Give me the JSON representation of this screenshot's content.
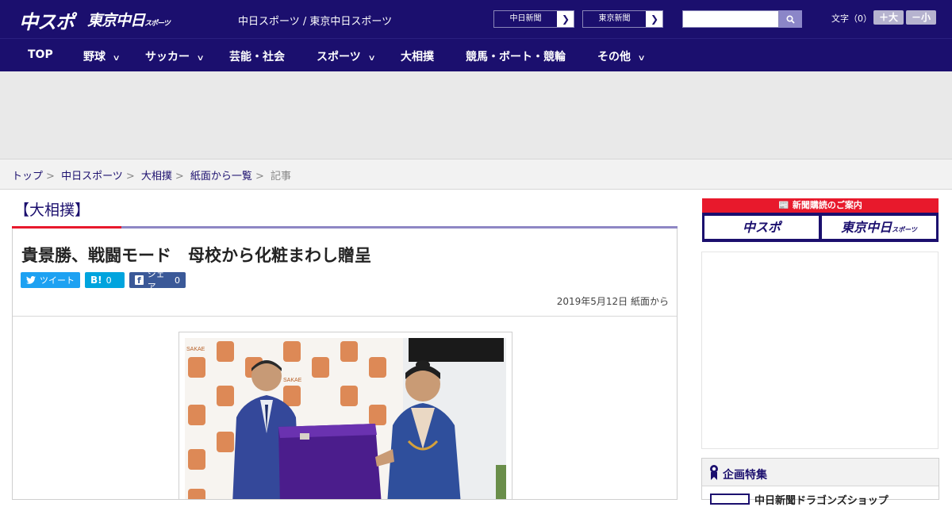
{
  "header": {
    "logo_main": "中スポ",
    "logo_tokyo": "東京中日",
    "logo_tokyo_sub": "スポーツ",
    "site_title": "中日スポーツ / 東京中日スポーツ",
    "ext_links": [
      {
        "label": "中日新聞"
      },
      {
        "label": "東京新聞"
      }
    ],
    "search": {
      "value": "",
      "placeholder": ""
    },
    "font_size_label": "文字（0）",
    "font_larger": "＋大",
    "font_smaller": "－小"
  },
  "nav": {
    "items": [
      {
        "label": "TOP",
        "has_menu": false
      },
      {
        "label": "野球",
        "has_menu": true
      },
      {
        "label": "サッカー",
        "has_menu": true
      },
      {
        "label": "芸能・社会",
        "has_menu": false
      },
      {
        "label": "スポーツ",
        "has_menu": true
      },
      {
        "label": "大相撲",
        "has_menu": false
      },
      {
        "label": "競馬・ボート・競輪",
        "has_menu": false
      },
      {
        "label": "その他",
        "has_menu": true
      }
    ]
  },
  "breadcrumb": {
    "items": [
      "トップ",
      "中日スポーツ",
      "大相撲",
      "紙面から一覧"
    ],
    "current": "記事"
  },
  "article": {
    "category": "【大相撲】",
    "headline": "貴景勝、戦闘モード　母校から化粧まわし贈呈",
    "share": {
      "tweet_label": "ツイート",
      "hatena_label": "B!",
      "hatena_count": "0",
      "facebook_label": "シェア",
      "facebook_count": "0"
    },
    "dateline": "2019年5月12日 紙面から",
    "photo_logo_text": "SAKAE"
  },
  "sidebar": {
    "subscribe_caption": "新聞購読のご案内",
    "subscribe_logo_1": "中スポ",
    "subscribe_logo_2": "東京中日",
    "subscribe_logo_2_sub": "スポーツ",
    "feature_title": "企画特集",
    "feature_item": "中日新聞ドラゴンズショップ"
  },
  "colors": {
    "brand": "#1b0f6e",
    "accent_red": "#e8192c",
    "twitter": "#1da1f2",
    "hatena": "#00a4de",
    "facebook": "#3b5998"
  }
}
